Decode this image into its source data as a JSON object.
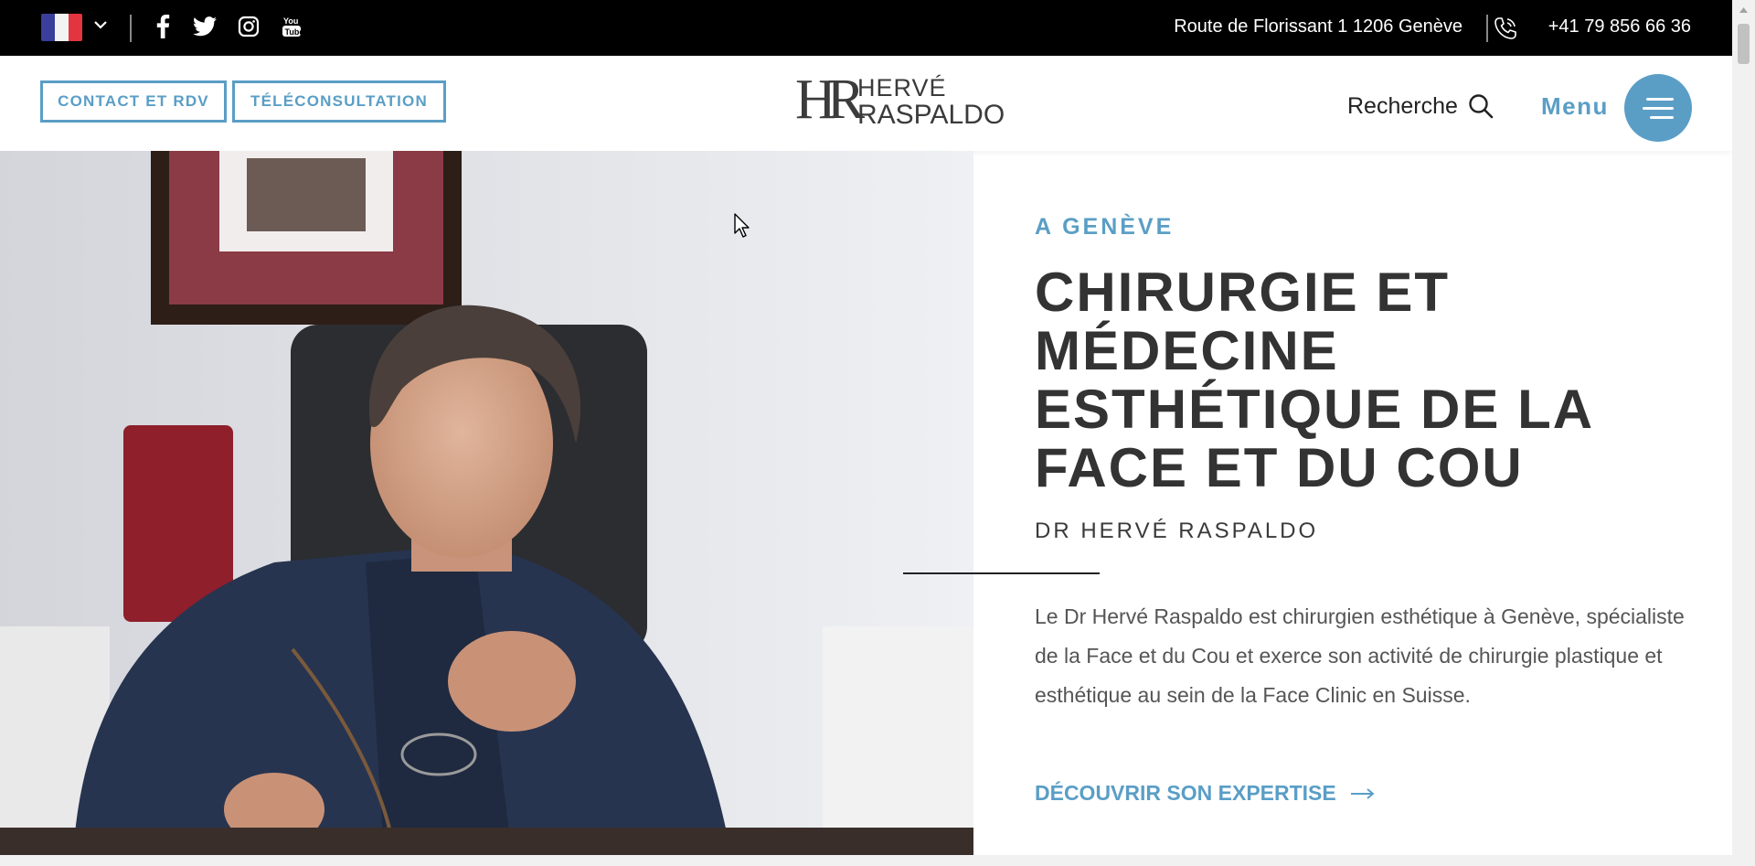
{
  "topbar": {
    "language": "fr",
    "social": [
      "facebook-icon",
      "twitter-icon",
      "instagram-icon",
      "youtube-icon"
    ],
    "address": "Route de Florissant 1 1206 Genève",
    "phone": "+41 79 856 66 36"
  },
  "header": {
    "contact_button": "CONTACT ET RDV",
    "teleconsult_button": "TÉLÉCONSULTATION",
    "logo_monogram": "HR",
    "logo_line1": "HERVÉ",
    "logo_line2": "RASPALDO",
    "search_label": "Recherche",
    "menu_label": "Menu"
  },
  "hero": {
    "kicker": "A GENÈVE",
    "title": "CHIRURGIE ET MÉDECINE ESTHÉTIQUE DE LA FACE ET DU COU",
    "subtitle": "DR HERVÉ RASPALDO",
    "description": "Le Dr Hervé Raspaldo est chirurgien esthétique à Genève, spécialiste de la Face et du Cou et exerce son activité de chirurgie plastique et esthétique au sein de la Face Clinic en Suisse.",
    "cta": "DÉCOUVRIR SON EXPERTISE"
  },
  "colors": {
    "accent": "#5a9ec6",
    "topbar": "#000000",
    "heading": "#333333"
  }
}
